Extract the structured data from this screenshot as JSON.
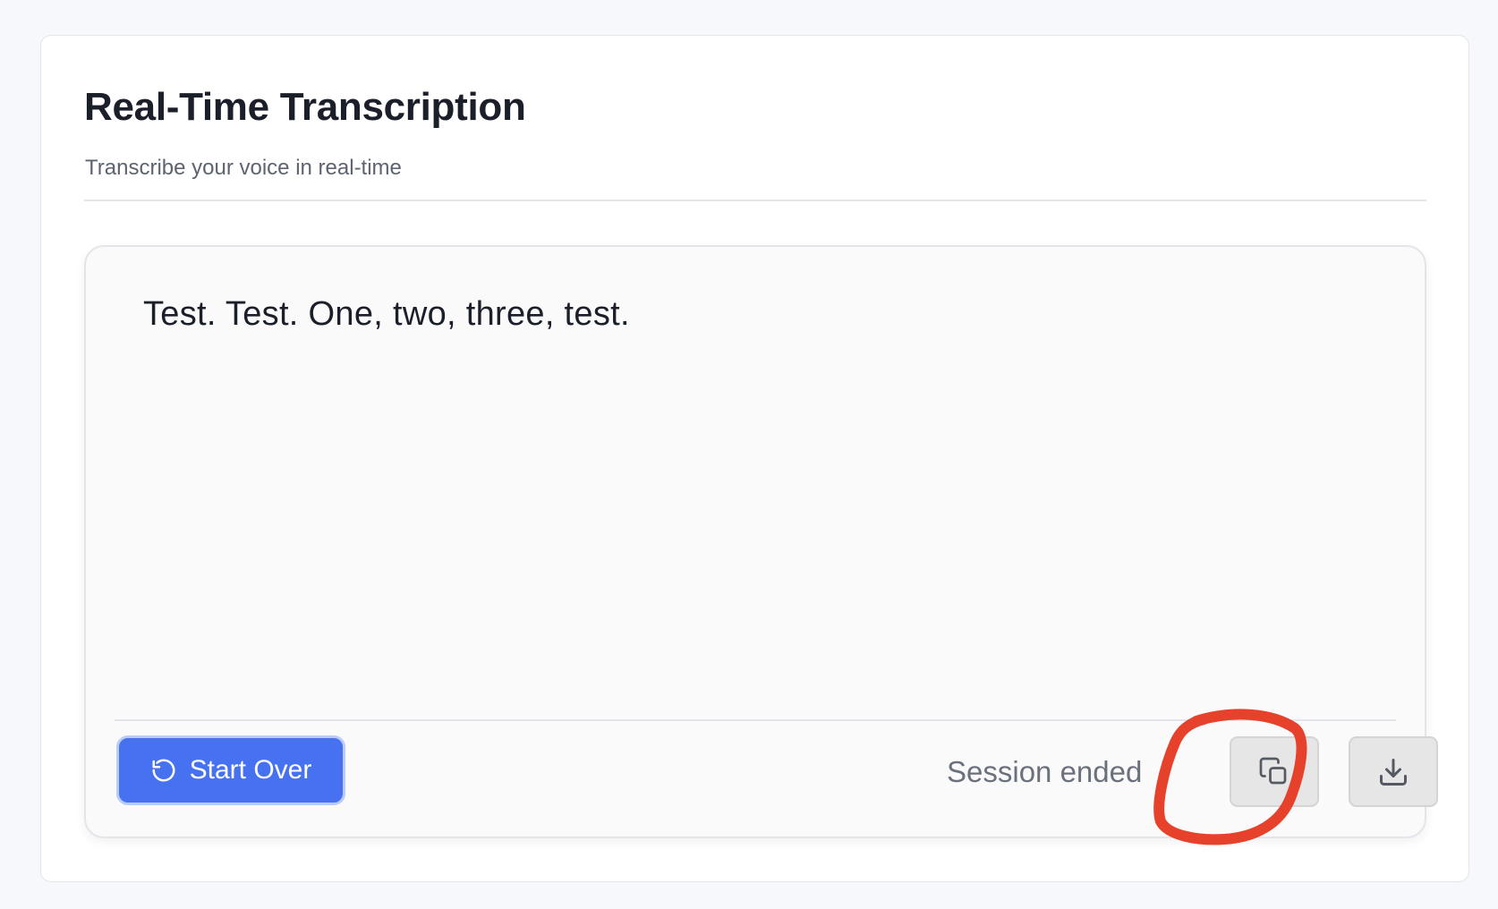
{
  "header": {
    "title": "Real-Time Transcription",
    "subtitle": "Transcribe your voice in real-time"
  },
  "transcript": {
    "text": "Test. Test. One, two, three, test."
  },
  "footer": {
    "start_over_label": "Start Over",
    "status": "Session ended",
    "copy_icon": "copy-icon",
    "download_icon": "download-icon"
  },
  "colors": {
    "primary": "#4671f0",
    "annotation": "#e5412b"
  }
}
